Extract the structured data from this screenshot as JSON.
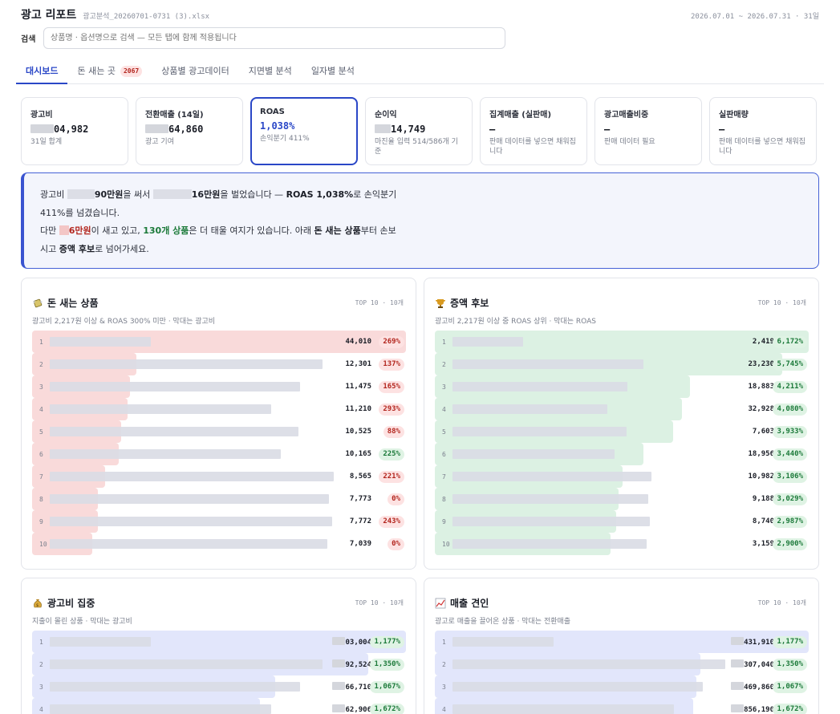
{
  "app": {
    "title": "광고 리포트",
    "file_name": "광고분석_20260701-0731 (3).xlsx",
    "date_range": "2026.07.01 ~ 2026.07.31 · 31일"
  },
  "search": {
    "label": "검색",
    "placeholder": "상품명 · 옵션명으로 검색 — 모든 탭에 함께 적용됩니다"
  },
  "tabs": [
    {
      "label": "대시보드",
      "active": true
    },
    {
      "label": "돈 새는 곳",
      "badge": "2067"
    },
    {
      "label": "상품별 광고데이터"
    },
    {
      "label": "지면별 분석"
    },
    {
      "label": "일자별 분석"
    }
  ],
  "kpis": [
    {
      "label": "광고비",
      "value": "04,982",
      "sub": "31일 합계",
      "masked": true
    },
    {
      "label": "전환매출 (14일)",
      "value": "64,860",
      "sub": "광고 기여",
      "masked": true
    },
    {
      "label": "ROAS",
      "value": "1,038%",
      "sub": "손익분기 411%",
      "active": true
    },
    {
      "label": "순이익",
      "value": "14,749",
      "sub": "마진율 입력 514/586개 기준",
      "masked": true
    },
    {
      "label": "집계매출 (실판매)",
      "value": "–",
      "sub": "판매 데이터를 넣으면 채워집니다"
    },
    {
      "label": "광고매출비중",
      "value": "–",
      "sub": "판매 데이터 필요"
    },
    {
      "label": "실판매량",
      "value": "–",
      "sub": "판매 데이터를 넣으면 채워집니다"
    }
  ],
  "insight": {
    "l1_a": "광고비 ",
    "l1_b": "90만원",
    "l1_c": "을 써서 ",
    "l1_d": "16만원",
    "l1_e": "을 벌었습니다 — ",
    "l1_f": "ROAS 1,038%",
    "l1_g": "로 손익분기",
    "l2": "411%를 넘겼습니다.",
    "l3_a": "다만 ",
    "l3_b": "6만원",
    "l3_c": "이 새고 있고, ",
    "l3_d": "130개 상품",
    "l3_e": "은 더 태울 여지가 있습니다. 아래 ",
    "l3_f": "돈 새는 상품",
    "l3_g": "부터 손보",
    "l4_a": "시고 ",
    "l4_b": "증액 후보",
    "l4_c": "로 넘어가세요."
  },
  "panels": {
    "leak": {
      "title": "돈 새는 상품",
      "icon": "money-wings-icon",
      "top": "TOP 10 · 10개",
      "sub": "광고비 2,217원 이상 & ROAS 300% 미만 · 막대는 광고비",
      "bar_color": "#f9dada",
      "rows": [
        {
          "rank": "1",
          "value": "44,010",
          "pill": "269%",
          "pill_type": "red",
          "share": 1.0
        },
        {
          "rank": "2",
          "value": "12,301",
          "pill": "137%",
          "pill_type": "red",
          "share": 0.28
        },
        {
          "rank": "3",
          "value": "11,475",
          "pill": "165%",
          "pill_type": "red",
          "share": 0.261
        },
        {
          "rank": "4",
          "value": "11,210",
          "pill": "293%",
          "pill_type": "red",
          "share": 0.255
        },
        {
          "rank": "5",
          "value": "10,525",
          "pill": "88%",
          "pill_type": "red",
          "share": 0.239
        },
        {
          "rank": "6",
          "value": "10,165",
          "pill": "225%",
          "pill_type": "green",
          "share": 0.231
        },
        {
          "rank": "7",
          "value": "8,565",
          "pill": "221%",
          "pill_type": "red",
          "share": 0.195
        },
        {
          "rank": "8",
          "value": "7,773",
          "pill": "0%",
          "pill_type": "red",
          "share": 0.177
        },
        {
          "rank": "9",
          "value": "7,772",
          "pill": "243%",
          "pill_type": "red",
          "share": 0.177
        },
        {
          "rank": "10",
          "value": "7,039",
          "pill": "0%",
          "pill_type": "red",
          "share": 0.16
        }
      ]
    },
    "boost": {
      "title": "증액 후보",
      "icon": "trophy-icon",
      "top": "TOP 10 · 10개",
      "sub": "광고비 2,217원 이상 중 ROAS 상위 · 막대는 ROAS",
      "bar_color": "#dcf1e3",
      "rows": [
        {
          "rank": "1",
          "value": "2,419",
          "pill": "6,172%",
          "pill_type": "green",
          "share": 1.0
        },
        {
          "rank": "2",
          "value": "23,230",
          "pill": "5,745%",
          "pill_type": "green",
          "share": 0.93
        },
        {
          "rank": "3",
          "value": "18,883",
          "pill": "4,211%",
          "pill_type": "green",
          "share": 0.682
        },
        {
          "rank": "4",
          "value": "32,928",
          "pill": "4,080%",
          "pill_type": "green",
          "share": 0.661
        },
        {
          "rank": "5",
          "value": "7,603",
          "pill": "3,933%",
          "pill_type": "green",
          "share": 0.637
        },
        {
          "rank": "6",
          "value": "18,956",
          "pill": "3,440%",
          "pill_type": "green",
          "share": 0.557
        },
        {
          "rank": "7",
          "value": "10,982",
          "pill": "3,106%",
          "pill_type": "green",
          "share": 0.503
        },
        {
          "rank": "8",
          "value": "9,188",
          "pill": "3,029%",
          "pill_type": "green",
          "share": 0.491
        },
        {
          "rank": "9",
          "value": "8,740",
          "pill": "2,987%",
          "pill_type": "green",
          "share": 0.484
        },
        {
          "rank": "10",
          "value": "3,159",
          "pill": "2,900%",
          "pill_type": "green",
          "share": 0.47
        }
      ]
    },
    "spend": {
      "title": "광고비 집중",
      "icon": "money-bag-icon",
      "top": "TOP 10 · 10개",
      "sub": "지출이 몰린 상품 · 막대는 광고비",
      "bar_color": "#e2e6fb",
      "rows": [
        {
          "rank": "1",
          "value": "03,004",
          "pill": "1,177%",
          "pill_type": "green",
          "share": 1.0,
          "masked": true
        },
        {
          "rank": "2",
          "value": "92,524",
          "pill": "1,350%",
          "pill_type": "green",
          "share": 0.9,
          "masked": true
        },
        {
          "rank": "3",
          "value": "66,710",
          "pill": "1,067%",
          "pill_type": "green",
          "share": 0.65,
          "masked": true
        },
        {
          "rank": "4",
          "value": "62,906",
          "pill": "1,672%",
          "pill_type": "green",
          "share": 0.61,
          "masked": true
        }
      ]
    },
    "sales": {
      "title": "매출 견인",
      "icon": "chart-up-icon",
      "top": "TOP 10 · 10개",
      "sub": "광고로 매출을 끌어온 상품 · 막대는 전환매출",
      "bar_color": "#e2e6fb",
      "rows": [
        {
          "rank": "1",
          "value": "431,910",
          "pill": "1,177%",
          "pill_type": "green",
          "share": 1.0,
          "masked": true
        },
        {
          "rank": "2",
          "value": "307,040",
          "pill": "1,350%",
          "pill_type": "green",
          "share": 0.71,
          "masked": true
        },
        {
          "rank": "3",
          "value": "469,860",
          "pill": "1,067%",
          "pill_type": "green",
          "share": 0.7,
          "masked": true
        },
        {
          "rank": "4",
          "value": "856,190",
          "pill": "1,672%",
          "pill_type": "green",
          "share": 0.69,
          "masked": true
        }
      ]
    }
  }
}
